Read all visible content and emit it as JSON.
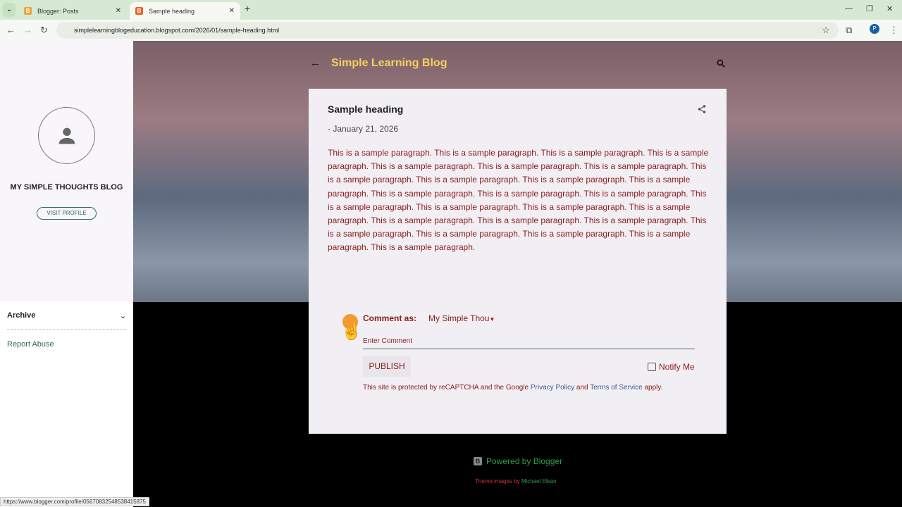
{
  "browser": {
    "tabs": [
      {
        "label": "Blogger: Posts",
        "active": false
      },
      {
        "label": "Sample heading",
        "active": true
      }
    ],
    "url": "simplelearningblogeducation.blogspot.com/2026/01/sample-heading.html",
    "profile_initial": "P",
    "status_url": "https://www.blogger.com/profile/05670832548538415875"
  },
  "sidebar": {
    "blog_name": "MY SIMPLE THOUGHTS BLOG",
    "visit_profile": "VISIT PROFILE",
    "archive": "Archive",
    "report_abuse": "Report Abuse"
  },
  "header": {
    "title": "Simple Learning Blog"
  },
  "post": {
    "title": "Sample heading",
    "date": "- January 21, 2026",
    "body": "This is a sample paragraph. This is a sample paragraph. This is a sample paragraph. This is a sample paragraph. This is a sample paragraph. This is a sample paragraph. This is a sample paragraph. This is a sample paragraph. This is a sample paragraph. This is a sample paragraph. This is a sample paragraph. This is a sample paragraph. This is a sample paragraph. This is a sample paragraph. This is a sample paragraph. This is a sample paragraph. This is a sample paragraph. This is a sample paragraph. This is a sample paragraph. This is a sample paragraph. This is a sample paragraph. This is a sample paragraph. This is a sample paragraph. This is a sample paragraph. This is a sample paragraph. This is a sample paragraph."
  },
  "comment": {
    "comment_as": "Comment as:",
    "identity": "My Simple Thou",
    "placeholder": "Enter Comment",
    "publish": "PUBLISH",
    "notify": "Notify Me",
    "legal_prefix": "This site is protected by reCAPTCHA and the Google ",
    "privacy": "Privacy Policy",
    "and": " and ",
    "terms": "Terms of Service",
    "apply": " apply."
  },
  "footer": {
    "powered": "Powered by Blogger",
    "theme_prefix": "Theme images by ",
    "theme_author": "Michael Elkan"
  }
}
